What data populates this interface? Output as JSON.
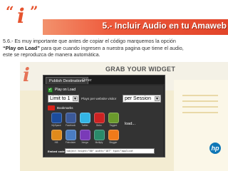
{
  "header": {
    "title": "5.- Incluir Audio en tu Amaweb",
    "logo_letter": "i",
    "logo_quote_open": "“",
    "logo_quote_close": "”"
  },
  "paragraph": {
    "line1": "5.6.- Es muy importante que antes de copiar el código marquemos la opción",
    "bold_label": "“Play on Load”",
    "line2_rest": " para que cuando ingresen a nuestra pagina que tiene el audio,",
    "line3": "este se reproduzca de manera automática."
  },
  "screenshot": {
    "background_logo": "i",
    "widget_title": "GRAB YOUR WIDGET",
    "tabs": [
      {
        "label": "Publish Destinations"
      },
      {
        "label": "Other"
      }
    ],
    "play_on_load_label": "Play on Load",
    "limit_select_value": "Limit to 1",
    "plays_text": "Plays per website visitor",
    "session_select_value": "per Session",
    "bookmarks_label": "Bookmarks",
    "loading_text": "load...",
    "embed_label": "Embed code",
    "embed_value": "<object height=\"80\" width=\"187\" type=\"applicat",
    "hp_label": "hp",
    "services": [
      {
        "label": "MySpace",
        "color": "#1b4c9c"
      },
      {
        "label": "Facebook",
        "color": "#3b5998"
      },
      {
        "label": "Twitter",
        "color": "#33b5e5"
      },
      {
        "label": "Bebo",
        "color": "#cc2222"
      },
      {
        "label": "Tagged",
        "color": "#6a9a2c"
      },
      {
        "label": "Hi5",
        "color": "#e08a1c"
      },
      {
        "label": "Friendster",
        "color": "#4a7cc2"
      },
      {
        "label": "Xanga",
        "color": "#7a3ab8"
      },
      {
        "label": "Multiply",
        "color": "#2a8a6a"
      },
      {
        "label": "Blogger",
        "color": "#f07a1a"
      }
    ]
  },
  "colors": {
    "accent": "#e6532e",
    "header_stripe": "#ee5a3c",
    "widget_bg": "#2a2a2a",
    "checkbox_green": "#3da33d"
  }
}
